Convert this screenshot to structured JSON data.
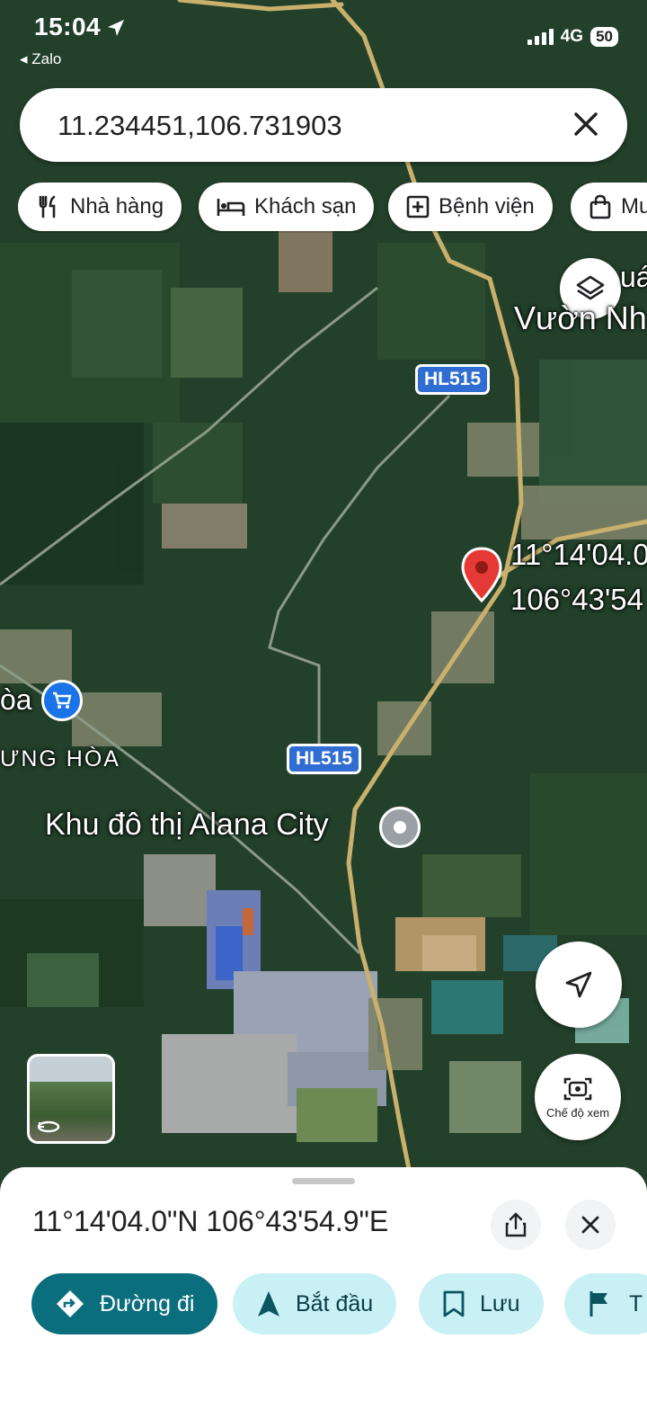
{
  "status_bar": {
    "time": "15:04",
    "back_app": "Zalo",
    "network": "4G",
    "battery": "50"
  },
  "search": {
    "value": "11.234451,106.731903"
  },
  "chips": [
    {
      "label": "Nhà hàng",
      "icon": "restaurant-icon"
    },
    {
      "label": "Khách sạn",
      "icon": "hotel-icon"
    },
    {
      "label": "Bệnh viện",
      "icon": "hospital-icon"
    },
    {
      "label": "Mu",
      "icon": "shopping-bag-icon"
    }
  ],
  "map": {
    "labels": {
      "vuon_top": "uá",
      "vuon": "Vườn Nh",
      "hoa": "òa",
      "hung_hoa": "ƯNG HÒA",
      "alana": "Khu đô thị Alana City",
      "marker_lat": "11°14'04.0",
      "marker_lng": "106°43'54"
    },
    "route_shields": [
      "HL515",
      "HL515"
    ],
    "view_mode_label": "Chế độ xem"
  },
  "sheet": {
    "coordinates": "11°14'04.0\"N 106°43'54.9\"E",
    "actions": [
      {
        "label": "Đường đi",
        "icon": "directions-icon"
      },
      {
        "label": "Bắt đầu",
        "icon": "navigation-arrow-icon"
      },
      {
        "label": "Lưu",
        "icon": "bookmark-icon"
      },
      {
        "label": "T",
        "icon": "flag-icon"
      }
    ]
  },
  "colors": {
    "accent": "#0b6e7d",
    "secondary": "#c9f1f5",
    "pin": "#d93025",
    "route_shield": "#2f6dd3"
  }
}
